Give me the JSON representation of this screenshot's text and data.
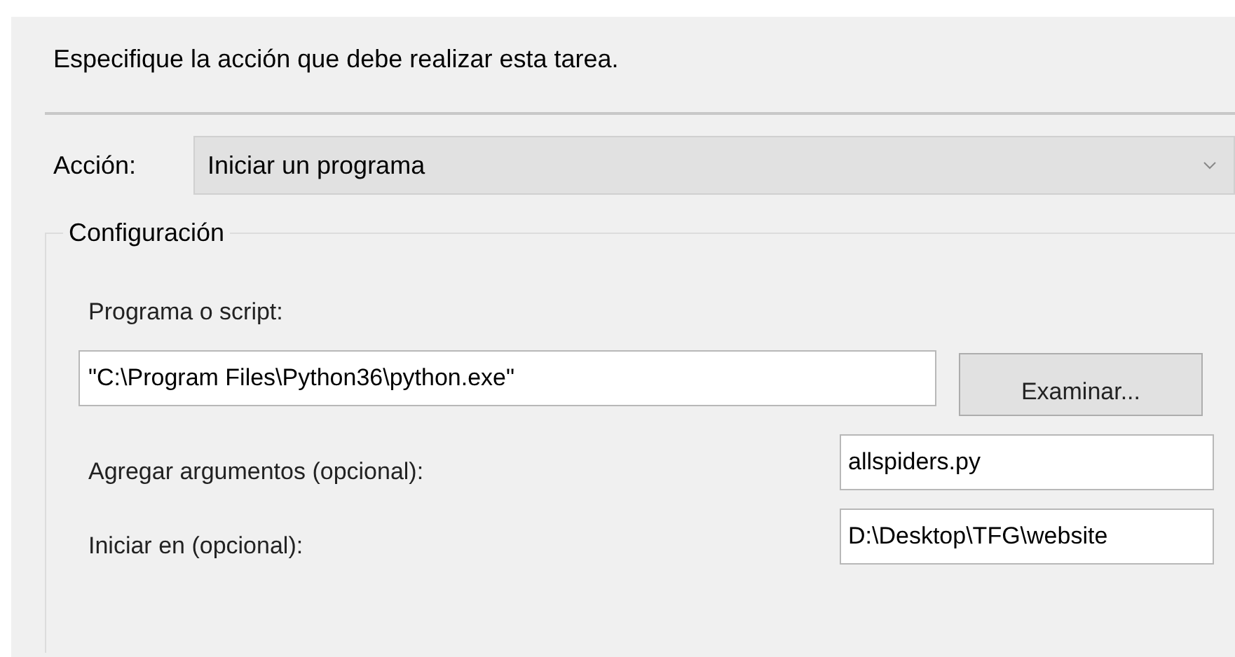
{
  "heading": "Especifique la acción que debe realizar esta tarea.",
  "action": {
    "label": "Acción:",
    "value": "Iniciar un programa"
  },
  "group": {
    "title": "Configuración",
    "program": {
      "label": "Programa o script:",
      "value": "\"C:\\Program Files\\Python36\\python.exe\"",
      "button": "Examinar..."
    },
    "fields": [
      {
        "label": "Agregar argumentos (opcional):",
        "value": "allspiders.py"
      },
      {
        "label": "Iniciar en (opcional):",
        "value": "D:\\Desktop\\TFG\\website"
      }
    ]
  }
}
